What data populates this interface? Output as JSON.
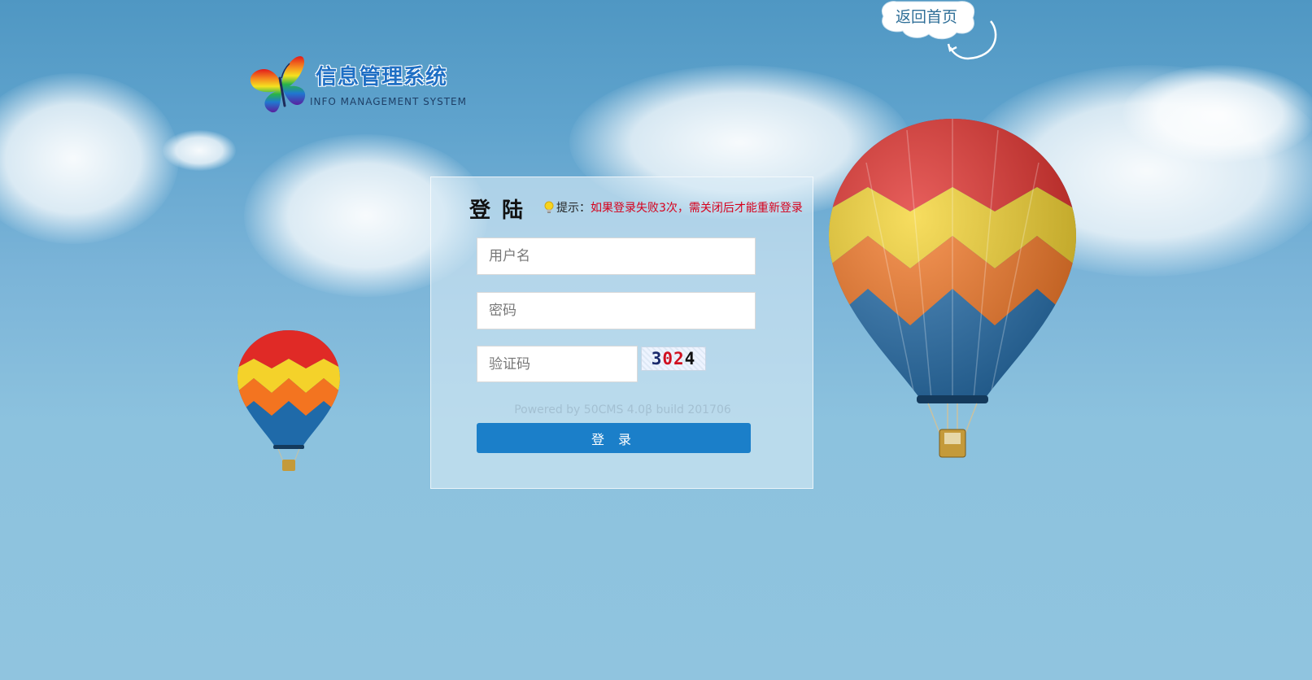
{
  "logo": {
    "title": "信息管理系统",
    "subtitle": "INFO MANAGEMENT SYSTEM",
    "icon": "rainbow-butterfly-icon"
  },
  "nav": {
    "home_link": "返回首页"
  },
  "login": {
    "title": "登陆",
    "tip_label": "提示：",
    "tip_message": "如果登录失败3次，需关闭后才能重新登录",
    "tip_icon": "lightbulb-icon",
    "username_placeholder": "用户名",
    "password_placeholder": "密码",
    "captcha_placeholder": "验证码",
    "captcha_chars": [
      {
        "char": "3",
        "color": "#1a2a6c"
      },
      {
        "char": "0",
        "color": "#d01020"
      },
      {
        "char": "2",
        "color": "#d01020"
      },
      {
        "char": "4",
        "color": "#111111"
      }
    ],
    "powered_by": "Powered by 50CMS 4.0β build 201706",
    "submit_label": "登 录"
  },
  "colors": {
    "button": "#1b7fc9",
    "tip_message": "#d6001c",
    "sky_top": "#4f97c3",
    "sky_bottom": "#90c4df"
  }
}
